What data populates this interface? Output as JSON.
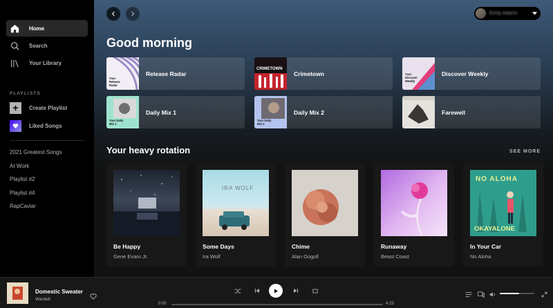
{
  "sidebar": {
    "nav": [
      {
        "label": "Home",
        "icon": "home-icon",
        "active": true
      },
      {
        "label": "Search",
        "icon": "search-icon",
        "active": false
      },
      {
        "label": "Your Library",
        "icon": "library-icon",
        "active": false
      }
    ],
    "playlists_title": "PLAYLISTS",
    "create_playlist": "Create Playlist",
    "liked_songs": "Liked Songs",
    "playlists": [
      "2021 Greatest Songs",
      "At Work",
      "Playlist #2",
      "Playlist #4",
      "RapCaviar"
    ]
  },
  "topbar": {
    "user_name": "Emily Adams"
  },
  "main": {
    "greeting": "Good morning",
    "quick_picks": [
      {
        "label": "Release Radar",
        "cover_text": "Your Release Radar"
      },
      {
        "label": "Crimetown",
        "cover_text": "CRIMETOWN"
      },
      {
        "label": "Discover Weekly",
        "cover_text": "Your Discover Weekly"
      },
      {
        "label": "Daily Mix 1",
        "cover_text": "Your Daily Mix 1"
      },
      {
        "label": "Daily Mix 2",
        "cover_text": "Your Daily Mix 2"
      },
      {
        "label": "Farewell",
        "cover_text": ""
      }
    ],
    "rotation_title": "Your heavy rotation",
    "see_more": "SEE MORE",
    "rotation": [
      {
        "title": "Be Happy",
        "artist": "Gene Evaro Jr.",
        "cover_text": ""
      },
      {
        "title": "Some Days",
        "artist": "Ira Wolf",
        "cover_text": "IRA WOLF"
      },
      {
        "title": "Chime",
        "artist": "Alan Gogoll",
        "cover_text": ""
      },
      {
        "title": "Runaway",
        "artist": "Beast Coast",
        "cover_text": ""
      },
      {
        "title": "In Your Car",
        "artist": "No Aloha",
        "cover_text": "NO ALOHA"
      }
    ],
    "in_your_car_bottom_text": "OKAYALONE"
  },
  "player": {
    "track": "Domestic Sweater",
    "artist": "Wardell",
    "elapsed": "0:00",
    "duration": "4:25",
    "progress": 0.0,
    "volume": 0.55
  },
  "colors": {
    "accent_green": "#1db954",
    "background": "#121212",
    "sidebar": "#000000"
  }
}
